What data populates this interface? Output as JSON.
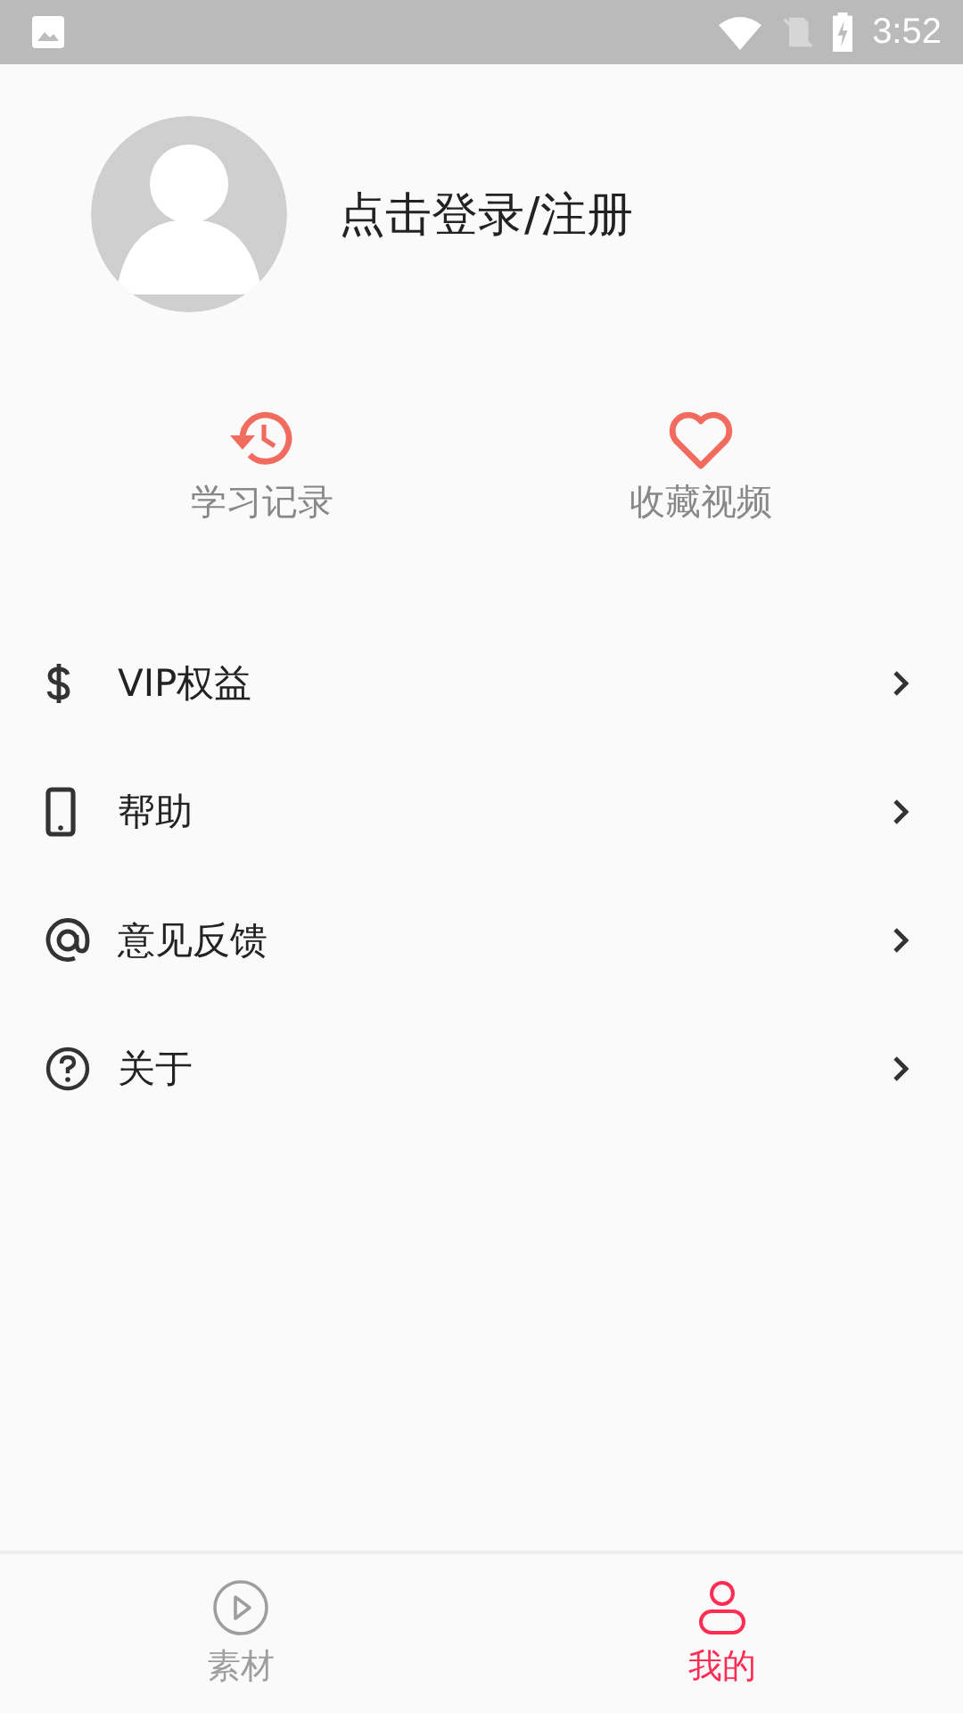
{
  "status_bar": {
    "time": "3:52"
  },
  "profile": {
    "login_label": "点击登录/注册"
  },
  "shortcuts": [
    {
      "kind": "history",
      "label": "学习记录"
    },
    {
      "kind": "heart",
      "label": "收藏视频"
    }
  ],
  "menu": [
    {
      "kind": "dollar",
      "label": "VIP权益"
    },
    {
      "kind": "phone",
      "label": "帮助"
    },
    {
      "kind": "at",
      "label": "意见反馈"
    },
    {
      "kind": "question",
      "label": "关于"
    }
  ],
  "bottom_nav": [
    {
      "kind": "play",
      "label": "素材",
      "selected": false
    },
    {
      "kind": "person",
      "label": "我的",
      "selected": true
    }
  ]
}
